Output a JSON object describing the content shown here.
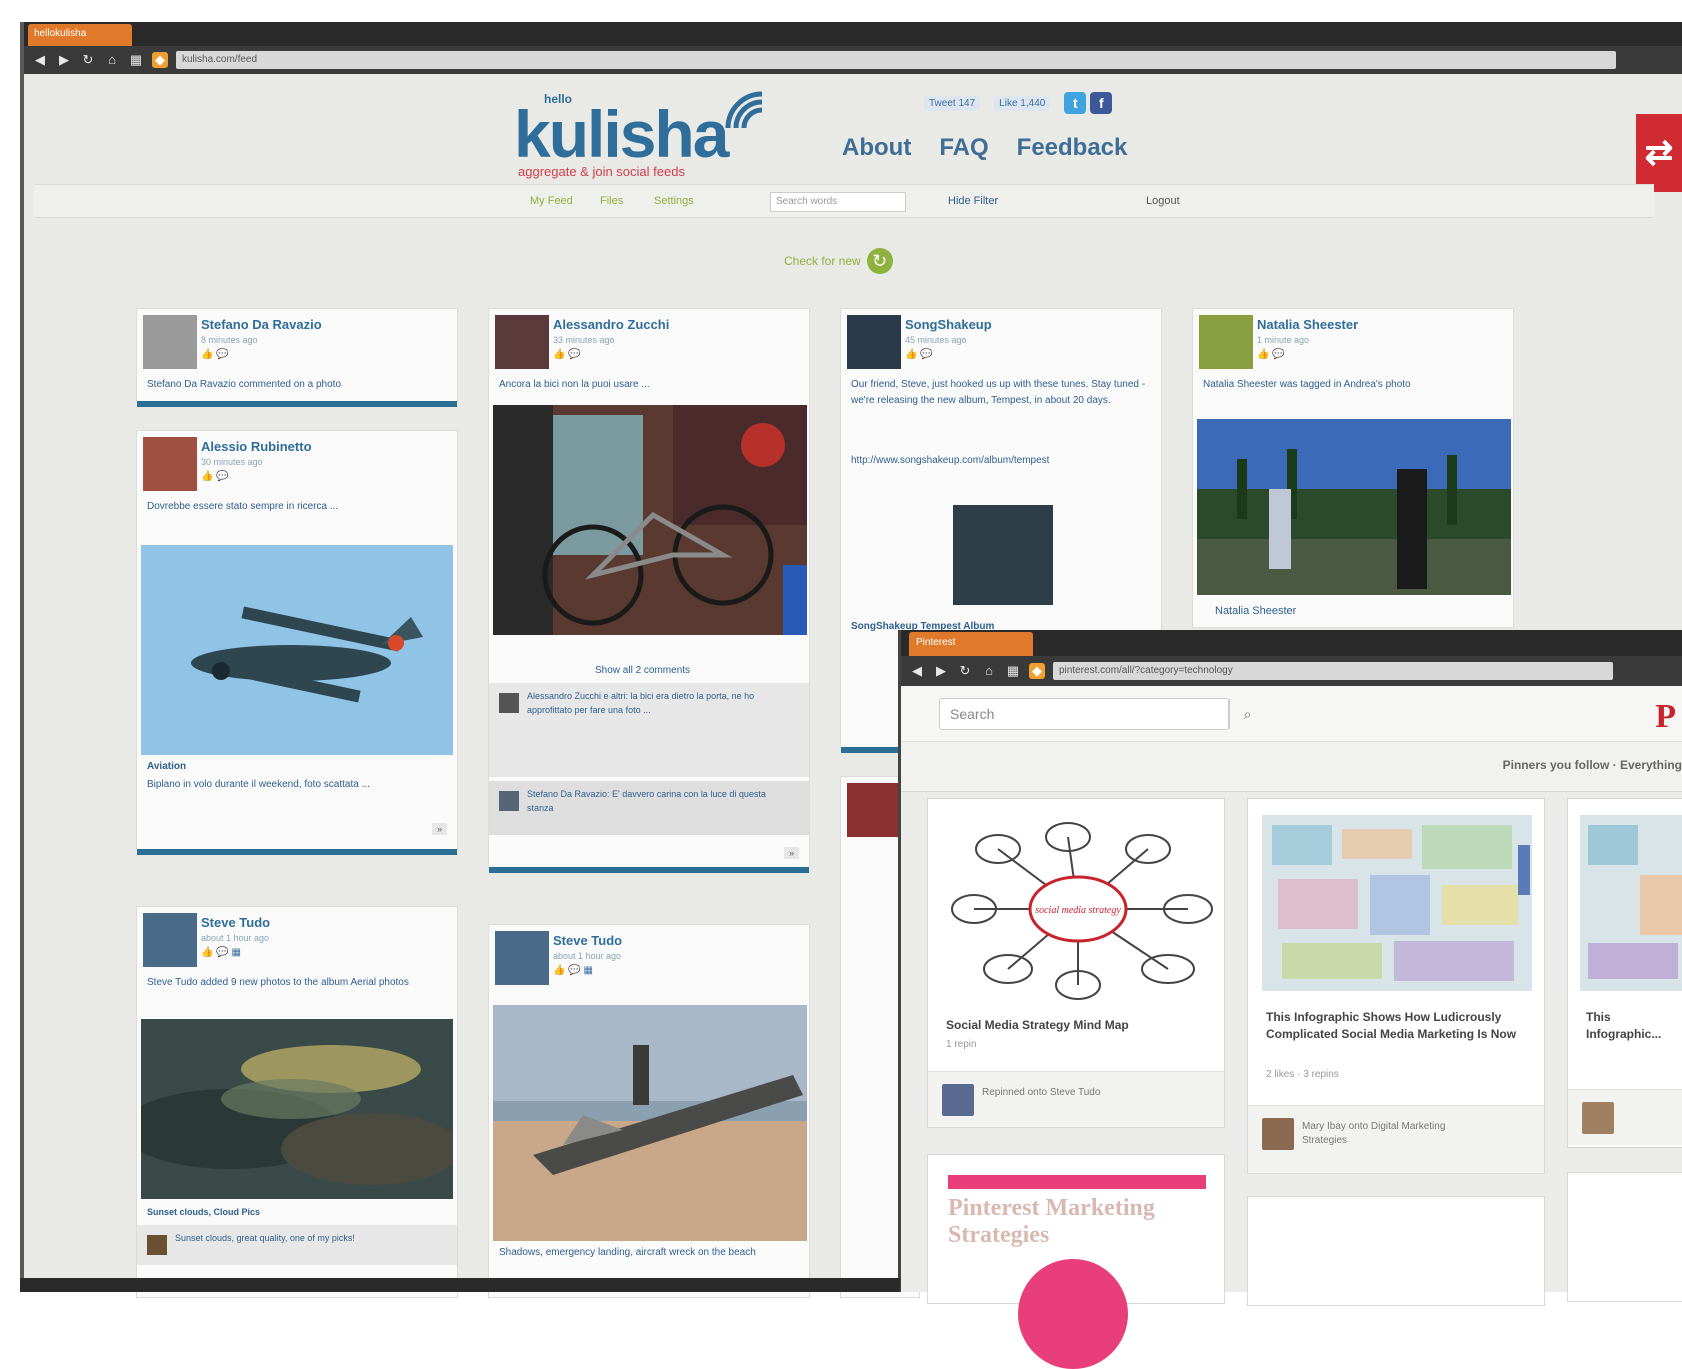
{
  "main_window": {
    "tab_label": "hellokulisha",
    "url": "kulisha.com/feed"
  },
  "site": {
    "logo_hello": "hello",
    "logo_name": "kulisha",
    "tagline": "aggregate & join social feeds",
    "nav": [
      "About",
      "FAQ",
      "Feedback"
    ],
    "share": {
      "tweet": "Tweet",
      "tweet_count": "147",
      "like": "Like",
      "like_count": "1,440"
    },
    "sub_nav": [
      "My Feed",
      "Files",
      "Settings"
    ],
    "search_placeholder": "Search words",
    "hide_filter": "Hide Filter",
    "logout": "Logout",
    "check_new": "Check for new"
  },
  "feed": {
    "col1": [
      {
        "name": "Stefano Da Ravazio",
        "time": "8 minutes ago",
        "text": "Stefano Da Ravazio commented on a photo"
      },
      {
        "name": "Alessio Rubinetto",
        "time": "30 minutes ago",
        "text": "Dovrebbe essere stato sempre in ricerca ...",
        "caption": "Aviation",
        "caption_text": "Biplano in volo durante il weekend, foto scattata ..."
      },
      {
        "name": "Steve Tudo",
        "time": "about 1 hour ago",
        "text": "Steve Tudo added 9 new photos to the album Aerial photos",
        "caption": "Sunset clouds, Cloud Pics",
        "comment": "Sunset clouds, great quality, one of my picks!"
      }
    ],
    "col2": [
      {
        "name": "Alessandro Zucchi",
        "time": "33 minutes ago",
        "text": "Ancora la bici non la puoi usare ...",
        "show_all": "Show all 2 comments",
        "comments": [
          "Alessandro Zucchi e altri: la bici era dietro la porta, ne ho approfittato per fare una foto ...",
          "Stefano Da Ravazio: E' davvero carina con la luce di questa stanza"
        ]
      },
      {
        "name": "Steve Tudo",
        "time": "about 1 hour ago",
        "text": "",
        "caption": "Shadows, emergency landing, aircraft wreck on the beach"
      }
    ],
    "col3": [
      {
        "name": "SongShakeup",
        "time": "45 minutes ago",
        "text": "Our friend, Steve, just hooked us up with these tunes. Stay tuned - we're releasing the new album, Tempest, in about 20 days.",
        "link": "http://www.songshakeup.com/album/tempest",
        "link_title": "SongShakeup Tempest Album"
      }
    ],
    "col4": [
      {
        "name": "Natalia Sheester",
        "time": "1 minute ago",
        "text": "Natalia Sheester was tagged in Andrea's photo",
        "footer": "Natalia Sheester"
      }
    ]
  },
  "pinterest_window": {
    "tab_label": "Pinterest",
    "url": "pinterest.com/all/?category=technology",
    "search_placeholder": "Search",
    "logo": "P",
    "subnav": "Pinners you follow · Everything",
    "pins": [
      {
        "title": "Social Media Strategy Mind Map",
        "meta": "1 repin",
        "attribution": "Repinned onto Steve Tudo"
      },
      {
        "title": "This Infographic Shows How Ludicrously Complicated Social Media Marketing Is Now",
        "meta": "2 likes · 3 repins",
        "attribution": "Mary Ibay onto Digital Marketing Strategies"
      },
      {
        "title": "This Infographic...",
        "meta": "",
        "attribution": ""
      },
      {
        "title": "Pinterest Marketing Strategies",
        "meta": "",
        "attribution": ""
      }
    ],
    "mindmap_center": "social media strategy"
  },
  "colors": {
    "brand_blue": "#2f6e9a",
    "accent_green": "#8fb23e",
    "card_border": "#2c6f96",
    "pin_red": "#c8232c",
    "tab_orange": "#e07a2a"
  }
}
